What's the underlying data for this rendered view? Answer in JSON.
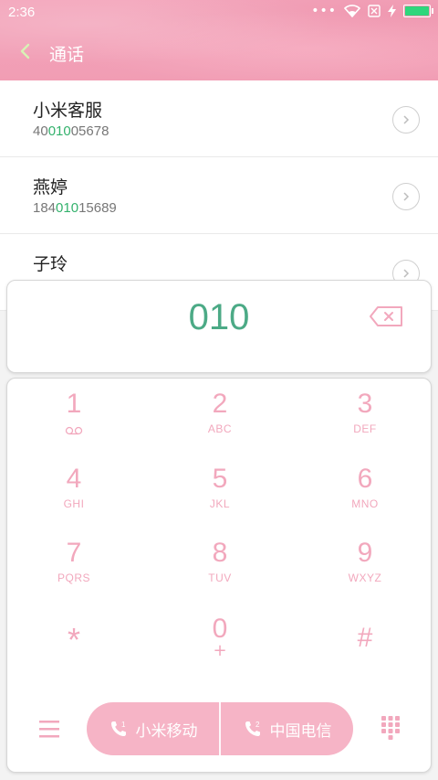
{
  "status": {
    "time": "2:36",
    "dots": "•••"
  },
  "header": {
    "title": "通话"
  },
  "contacts": [
    {
      "name": "小米客服",
      "number_pre": "40",
      "number_hl": "010",
      "number_post": "05678"
    },
    {
      "name": "燕婷",
      "number_pre": "184",
      "number_hl": "010",
      "number_post": "15689"
    },
    {
      "name": "子玲",
      "number_pre": "",
      "number_hl": "",
      "number_post": ""
    }
  ],
  "dial": {
    "input": "010"
  },
  "keypad": [
    {
      "digit": "1",
      "letters": ""
    },
    {
      "digit": "2",
      "letters": "ABC"
    },
    {
      "digit": "3",
      "letters": "DEF"
    },
    {
      "digit": "4",
      "letters": "GHI"
    },
    {
      "digit": "5",
      "letters": "JKL"
    },
    {
      "digit": "6",
      "letters": "MNO"
    },
    {
      "digit": "7",
      "letters": "PQRS"
    },
    {
      "digit": "8",
      "letters": "TUV"
    },
    {
      "digit": "9",
      "letters": "WXYZ"
    },
    {
      "digit": "*",
      "letters": ""
    },
    {
      "digit": "0",
      "letters": "+"
    },
    {
      "digit": "#",
      "letters": ""
    }
  ],
  "call_buttons": [
    {
      "label": "小米移动",
      "sim": "1"
    },
    {
      "label": "中国电信",
      "sim": "2"
    }
  ],
  "colors": {
    "accent_pink": "#f2a8bd",
    "match_green": "#34b26d",
    "dialed_green": "#4caa86",
    "battery_green": "#2fd67c"
  },
  "icons": [
    "back-arrow-icon",
    "wifi-icon",
    "sim-off-icon",
    "charging-icon",
    "battery-icon",
    "chevron-right-icon",
    "backspace-icon",
    "voicemail-icon",
    "menu-icon",
    "phone-icon",
    "dialpad-icon"
  ]
}
